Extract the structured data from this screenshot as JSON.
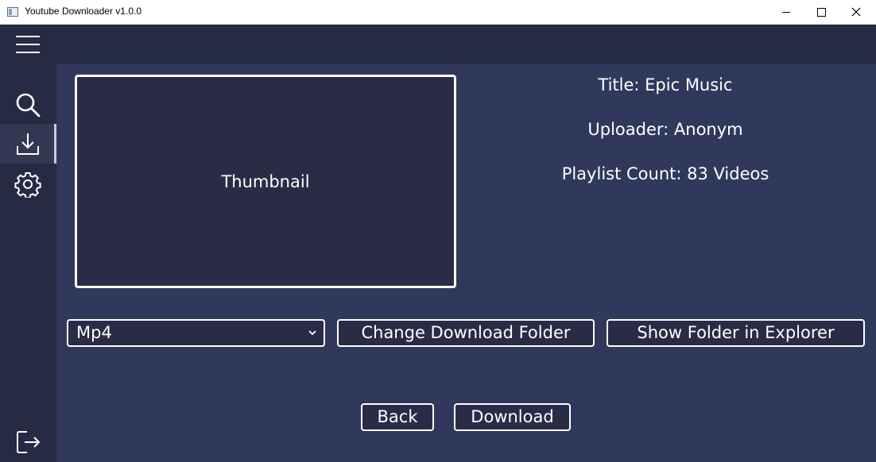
{
  "window": {
    "title": "Youtube Downloader v1.0.0"
  },
  "sidebar": {
    "items": [
      {
        "name": "search",
        "icon": "search-icon"
      },
      {
        "name": "download",
        "icon": "download-icon",
        "active": true
      },
      {
        "name": "settings",
        "icon": "gear-icon"
      },
      {
        "name": "exit",
        "icon": "exit-icon"
      }
    ]
  },
  "video": {
    "thumbnail_label": "Thumbnail",
    "title": "Title: Epic Music",
    "uploader": "Uploader: Anonym",
    "playlist_count": "Playlist Count: 83 Videos"
  },
  "controls": {
    "format_selected": "Mp4",
    "change_folder_label": "Change Download Folder",
    "show_folder_label": "Show Folder in Explorer",
    "back_label": "Back",
    "download_label": "Download"
  },
  "colors": {
    "sidebar_bg": "#262a45",
    "main_bg": "#30395b",
    "button_bg": "#2a2c47",
    "text": "#ffffff"
  }
}
